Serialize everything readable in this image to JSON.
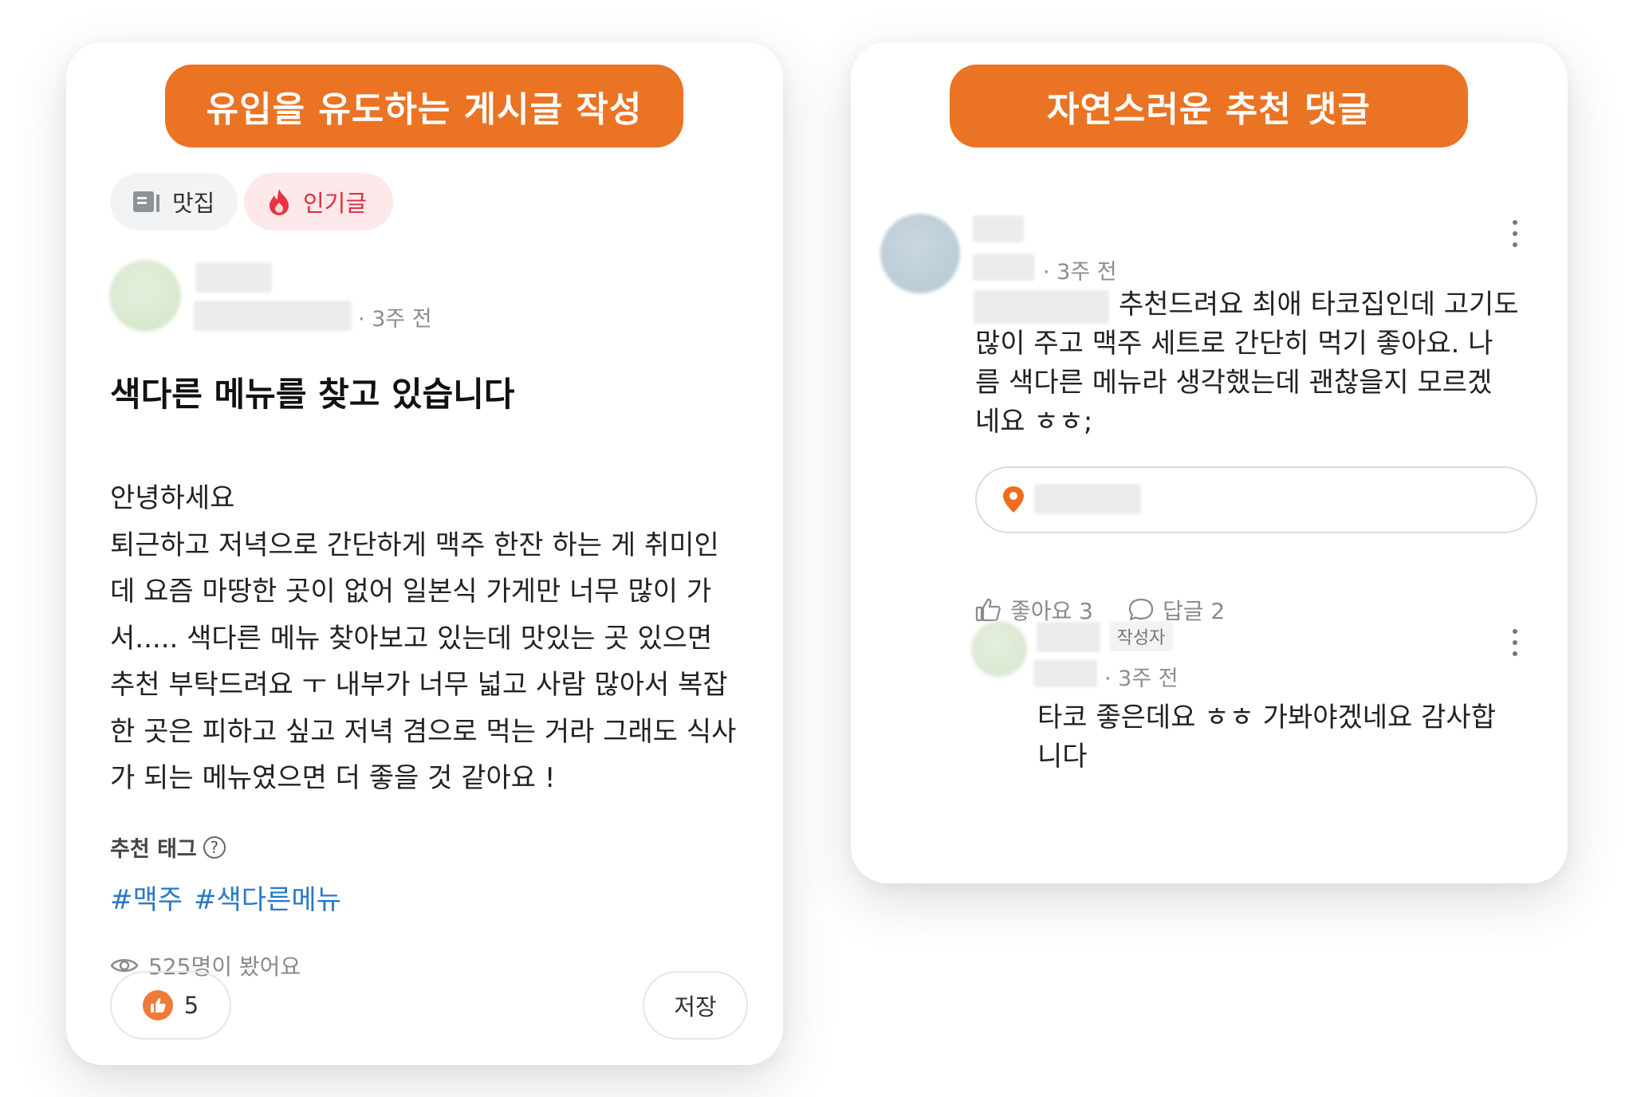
{
  "colors": {
    "banner": "#ea7324",
    "tag_link": "#2a78c6",
    "hot_chip_text": "#e02d3c",
    "hot_chip_bg": "#fde8ea",
    "like_orange": "#f07a3a"
  },
  "left": {
    "banner": "유입을 유도하는 게시글 작성",
    "chips": [
      {
        "icon": "notebook-icon",
        "label": "맛집"
      },
      {
        "icon": "fire-icon",
        "label": "인기글"
      }
    ],
    "author": {
      "time": "3주 전"
    },
    "post": {
      "title": "색다른 메뉴를 찾고 있습니다",
      "body_lines": [
        "안녕하세요",
        "퇴근하고 저녁으로 간단하게 맥주 한잔 하는 게 취미인",
        "데 요즘 마땅한 곳이 없어 일본식 가게만 너무 많이 가",
        "서..... 색다른 메뉴 찾아보고 있는데 맛있는 곳 있으면",
        "추천 부탁드려요 ㅜ 내부가 너무 넓고 사람 많아서 복잡",
        "한 곳은 피하고 싶고 저녁 겸으로 먹는 거라 그래도 식사",
        "가 되는 메뉴였으면 더 좋을 것 같아요 !"
      ]
    },
    "tags_label": "추천 태그",
    "help_icon": "?",
    "tags": [
      "#맥주",
      "#색다른메뉴"
    ],
    "views": "525명이 봤어요",
    "like_count": "5",
    "save_label": "저장"
  },
  "right": {
    "banner": "자연스러운 추천 댓글",
    "comment": {
      "time": "3주 전",
      "text_lines": [
        "추천드려요 최애 타코집인데 고기도",
        "많이 주고 맥주 세트로 간단히 먹기 좋아요. 나",
        "름 색다른 메뉴라 생각했는데 괜찮을지 모르겠",
        "네요 ㅎㅎ;"
      ],
      "like_label": "좋아요 3",
      "reply_label": "답글 2"
    },
    "reply": {
      "badge": "작성자",
      "time": "3주 전",
      "text_lines": [
        "타코 좋은데요 ㅎㅎ 가봐야겠네요 감사합",
        "니다"
      ]
    }
  }
}
